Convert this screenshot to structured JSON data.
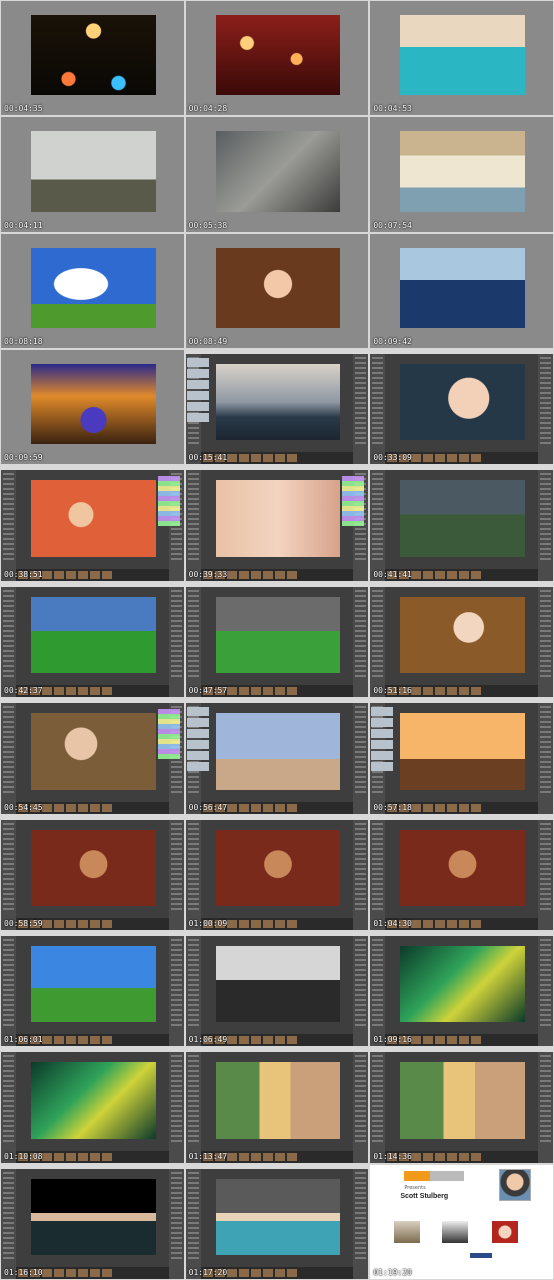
{
  "sheet": {
    "title": "",
    "cells": [
      {
        "ts": "00:04:35",
        "kind": "photo",
        "img": "eiffel-bokeh"
      },
      {
        "ts": "00:04:28",
        "kind": "photo",
        "img": "candles"
      },
      {
        "ts": "00:04:53",
        "kind": "photo",
        "img": "gondola"
      },
      {
        "ts": "00:04:11",
        "kind": "photo",
        "img": "balloons"
      },
      {
        "ts": "00:05:38",
        "kind": "photo",
        "img": "eagle"
      },
      {
        "ts": "00:07:54",
        "kind": "photo",
        "img": "horses"
      },
      {
        "ts": "00:08:18",
        "kind": "photo",
        "img": "clouds"
      },
      {
        "ts": "00:08:49",
        "kind": "photo",
        "img": "portrait-hair"
      },
      {
        "ts": "00:09:42",
        "kind": "photo",
        "img": "gondolas"
      },
      {
        "ts": "00:09:59",
        "kind": "photo",
        "img": "eiffel-under"
      },
      {
        "ts": "00:15:41",
        "kind": "app",
        "img": "seascape"
      },
      {
        "ts": "00:33:09",
        "kind": "app",
        "img": "girl"
      },
      {
        "ts": "00:38:51",
        "kind": "app",
        "img": "monk-umbrella"
      },
      {
        "ts": "00:39:33",
        "kind": "app",
        "img": "monks"
      },
      {
        "ts": "00:41:41",
        "kind": "app",
        "img": "tree-field"
      },
      {
        "ts": "00:42:37",
        "kind": "app",
        "img": "tree-color"
      },
      {
        "ts": "00:47:57",
        "kind": "app",
        "img": "hills"
      },
      {
        "ts": "00:51:16",
        "kind": "app",
        "img": "curly"
      },
      {
        "ts": "00:54:45",
        "kind": "app",
        "img": "curly-texture"
      },
      {
        "ts": "00:56:47",
        "kind": "app",
        "img": "camel-blue"
      },
      {
        "ts": "00:57:18",
        "kind": "app",
        "img": "camel-sunset"
      },
      {
        "ts": "00:58:59",
        "kind": "app",
        "img": "hooded-boy"
      },
      {
        "ts": "01:00:09",
        "kind": "app",
        "img": "hooded-boy"
      },
      {
        "ts": "01:04:30",
        "kind": "app",
        "img": "hooded-boy"
      },
      {
        "ts": "01:06:01",
        "kind": "app",
        "img": "green-hill"
      },
      {
        "ts": "01:06:49",
        "kind": "app",
        "img": "bw-hill"
      },
      {
        "ts": "01:09:16",
        "kind": "app",
        "img": "green-dunes"
      },
      {
        "ts": "01:10:08",
        "kind": "app",
        "img": "green-dunes"
      },
      {
        "ts": "01:13:47",
        "kind": "app",
        "img": "boy-blonde"
      },
      {
        "ts": "01:14:36",
        "kind": "app",
        "img": "boy-blonde"
      },
      {
        "ts": "01:16:10",
        "kind": "app",
        "img": "reflection-dark"
      },
      {
        "ts": "01:17:20",
        "kind": "app",
        "img": "reflection-light"
      },
      {
        "ts": "01:19:20",
        "kind": "ad",
        "img": "ad"
      }
    ]
  },
  "ad": {
    "presents": "Presents",
    "name": "Scott Stulberg",
    "brand_color": "#f29a1a"
  },
  "colors": {
    "page_bg": "#f2f2f2",
    "photo_cell": "#8a8a8a",
    "app_cell": "#3e3e3e"
  }
}
